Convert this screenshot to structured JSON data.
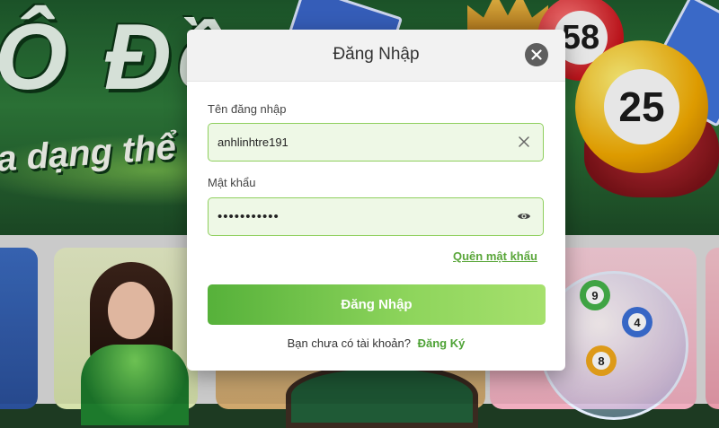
{
  "background": {
    "banner_title": "Ô Đề",
    "banner_subtitle": "a dạng thể loại",
    "ball_numbers": [
      "58",
      "25"
    ],
    "mini_ball_numbers": [
      "9",
      "4",
      "8"
    ]
  },
  "login_modal": {
    "title": "Đăng Nhập",
    "close_icon": "close-icon",
    "username_label": "Tên đăng nhập",
    "username_value": "anhlinhtre191",
    "username_clear_icon": "clear-icon",
    "password_label": "Mật khẩu",
    "password_value": "•••••••••••",
    "password_toggle_icon": "eye-icon",
    "forgot_password": "Quên mật khẩu",
    "submit_label": "Đăng Nhập",
    "no_account_text": "Bạn chưa có tài khoản?",
    "register_link": "Đăng Ký"
  },
  "colors": {
    "accent": "#5aa63a",
    "field_border": "#8fcf5e",
    "field_bg": "#eef8e6",
    "close_bg": "#5e5e5e"
  }
}
